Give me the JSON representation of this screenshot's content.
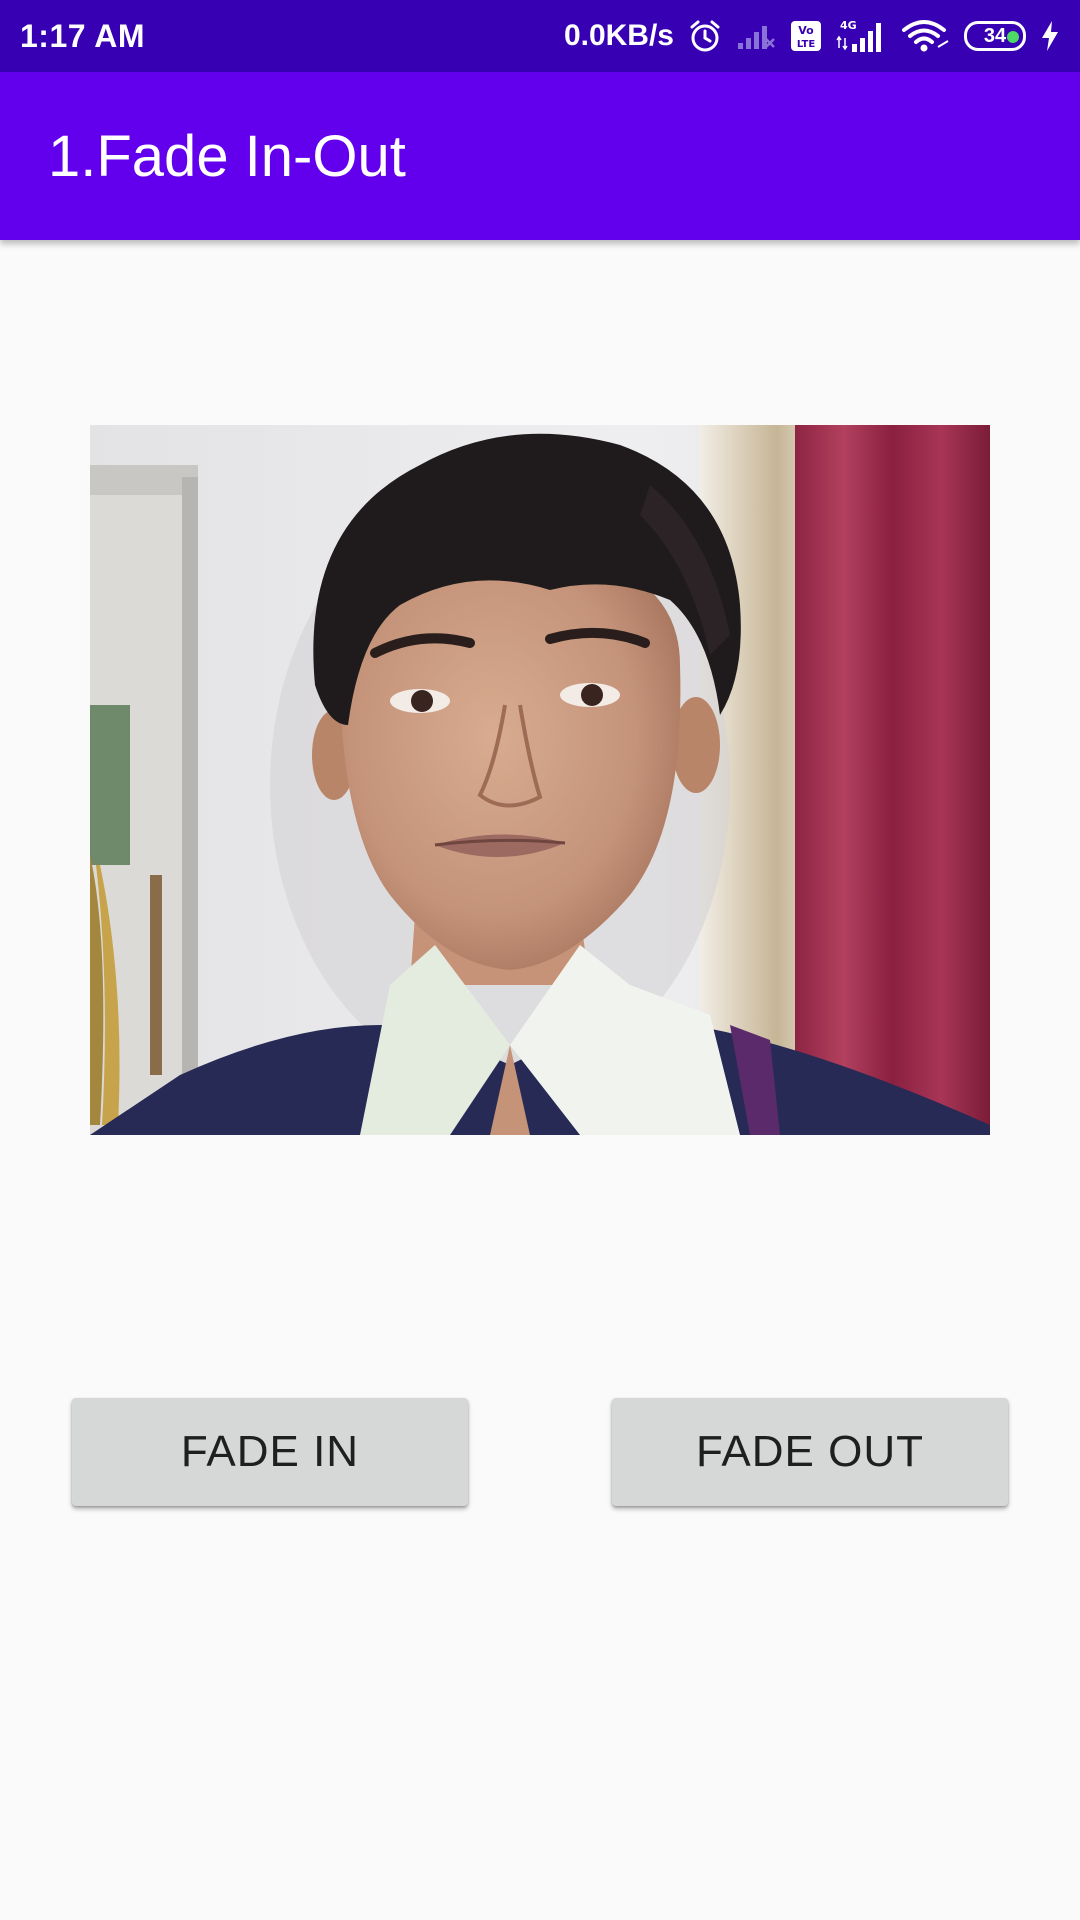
{
  "status_bar": {
    "time": "1:17 AM",
    "net_speed": "0.0KB/s",
    "volte_label": "Vo LTE",
    "network_type": "4G",
    "battery_level": "34",
    "icons": [
      "alarm-icon",
      "signal-off-icon",
      "volte-icon",
      "cellular-signal-icon",
      "wifi-icon",
      "battery-icon",
      "charging-icon"
    ]
  },
  "app_bar": {
    "title": "1.Fade In-Out",
    "color": "#6200ee"
  },
  "image": {
    "description_icon": "portrait-photo"
  },
  "buttons": {
    "fade_in": "FADE IN",
    "fade_out": "FADE OUT"
  },
  "colors": {
    "status_bar": "#3700b3",
    "app_bar": "#6200ee",
    "background": "#fafafa",
    "button": "#d6d7d7"
  }
}
